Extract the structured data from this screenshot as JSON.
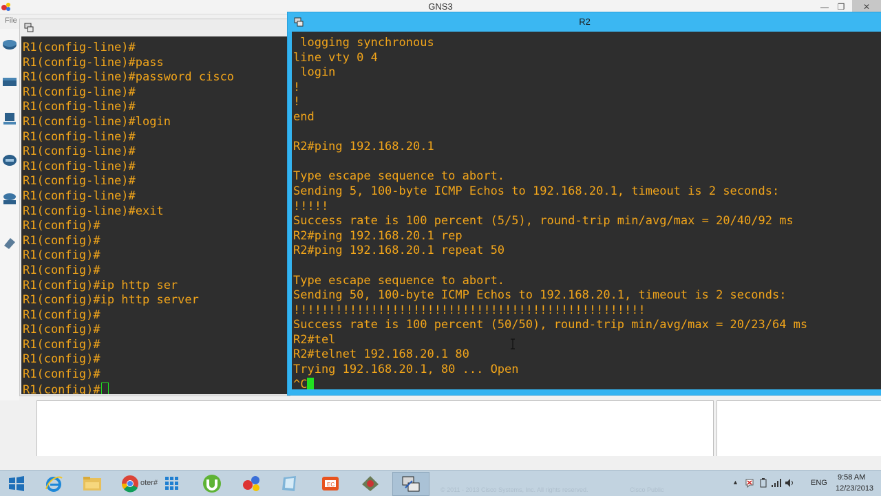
{
  "app": {
    "title": "GNS3",
    "menu_first": "File"
  },
  "r1": {
    "lines": [
      "R1(config-line)#",
      "R1(config-line)#pass",
      "R1(config-line)#password cisco",
      "R1(config-line)#",
      "R1(config-line)#",
      "R1(config-line)#login",
      "R1(config-line)#",
      "R1(config-line)#",
      "R1(config-line)#",
      "R1(config-line)#",
      "R1(config-line)#",
      "R1(config-line)#exit",
      "R1(config)#",
      "R1(config)#",
      "R1(config)#",
      "R1(config)#",
      "R1(config)#ip http ser",
      "R1(config)#ip http server",
      "R1(config)#",
      "R1(config)#",
      "R1(config)#",
      "R1(config)#",
      "R1(config)#",
      "R1(config)#"
    ]
  },
  "r2": {
    "title": "R2",
    "lines": [
      " logging synchronous",
      "line vty 0 4",
      " login",
      "!",
      "!",
      "end",
      "",
      "R2#ping 192.168.20.1",
      "",
      "Type escape sequence to abort.",
      "Sending 5, 100-byte ICMP Echos to 192.168.20.1, timeout is 2 seconds:",
      "!!!!!",
      "Success rate is 100 percent (5/5), round-trip min/avg/max = 20/40/92 ms",
      "R2#ping 192.168.20.1 rep",
      "R2#ping 192.168.20.1 repeat 50",
      "",
      "Type escape sequence to abort.",
      "Sending 50, 100-byte ICMP Echos to 192.168.20.1, timeout is 2 seconds:",
      "!!!!!!!!!!!!!!!!!!!!!!!!!!!!!!!!!!!!!!!!!!!!!!!!!!",
      "Success rate is 100 percent (50/50), round-trip min/avg/max = 20/23/64 ms",
      "R2#tel",
      "R2#telnet 192.168.20.1 80",
      "Trying 192.168.20.1, 80 ... Open",
      "^C"
    ]
  },
  "taskbar": {
    "chrome_label": "oter#",
    "tray_lang": "ENG",
    "clock_time": "9:58 AM",
    "clock_date": "12/23/2013",
    "watermark": "© 2011 - 2013 Cisco Systems, Inc. All rights reserved.",
    "watermark2": "Cisco Public"
  },
  "colors": {
    "terminal_bg": "#2e2e2e",
    "terminal_fg": "#f2a51a",
    "cursor": "#21e021",
    "r2_frame": "#33b3f1"
  }
}
